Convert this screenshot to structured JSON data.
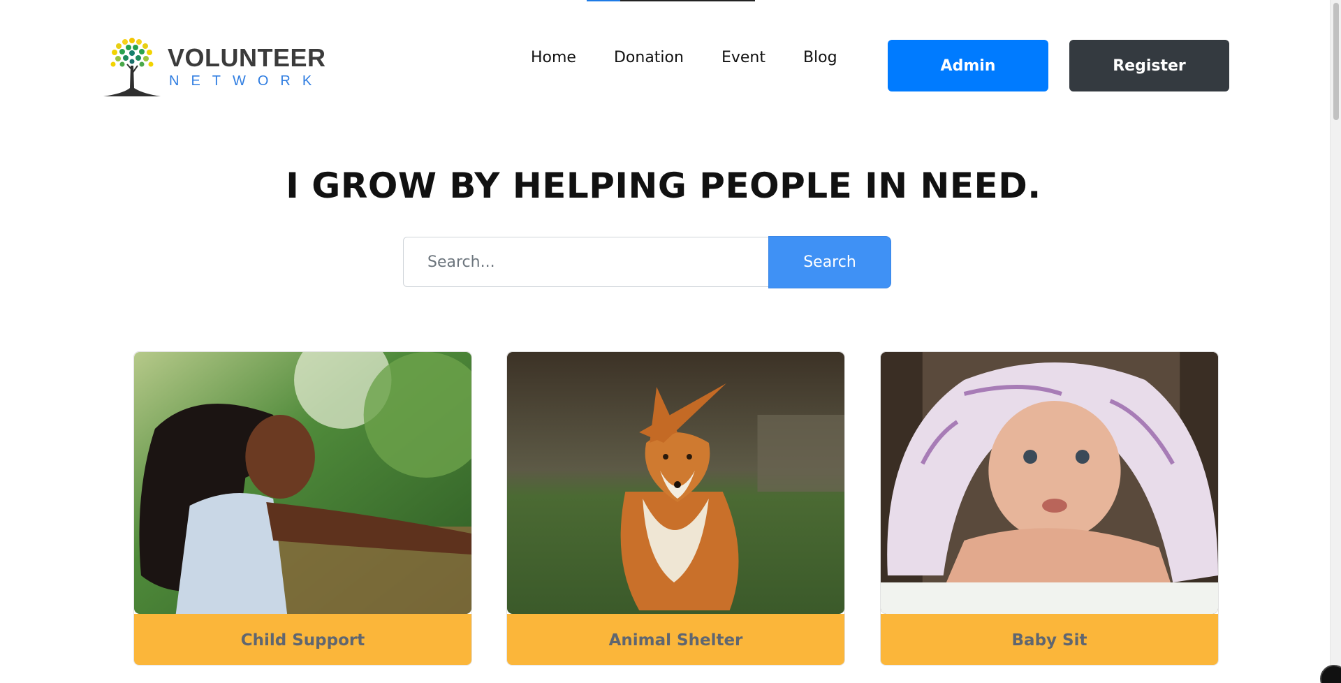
{
  "header": {
    "logo": {
      "word1": "VOLUNTEER",
      "word2": "NETWORK"
    },
    "nav": [
      {
        "label": "Home"
      },
      {
        "label": "Donation"
      },
      {
        "label": "Event"
      },
      {
        "label": "Blog"
      }
    ],
    "admin_label": "Admin",
    "register_label": "Register"
  },
  "hero": {
    "title": "I GROW BY HELPING PEOPLE IN NEED.",
    "search_placeholder": "Search...",
    "search_button": "Search"
  },
  "cards": [
    {
      "label": "Child Support",
      "image_icon": "child-photo"
    },
    {
      "label": "Animal Shelter",
      "image_icon": "fox-photo"
    },
    {
      "label": "Baby Sit",
      "image_icon": "baby-photo"
    }
  ],
  "colors": {
    "primary": "#007bff",
    "dark": "#343a40",
    "search": "#3f91f5",
    "card_label_bg": "#fbb63a",
    "card_label_text": "#5f6670",
    "logo_blue": "#2f7de1"
  }
}
